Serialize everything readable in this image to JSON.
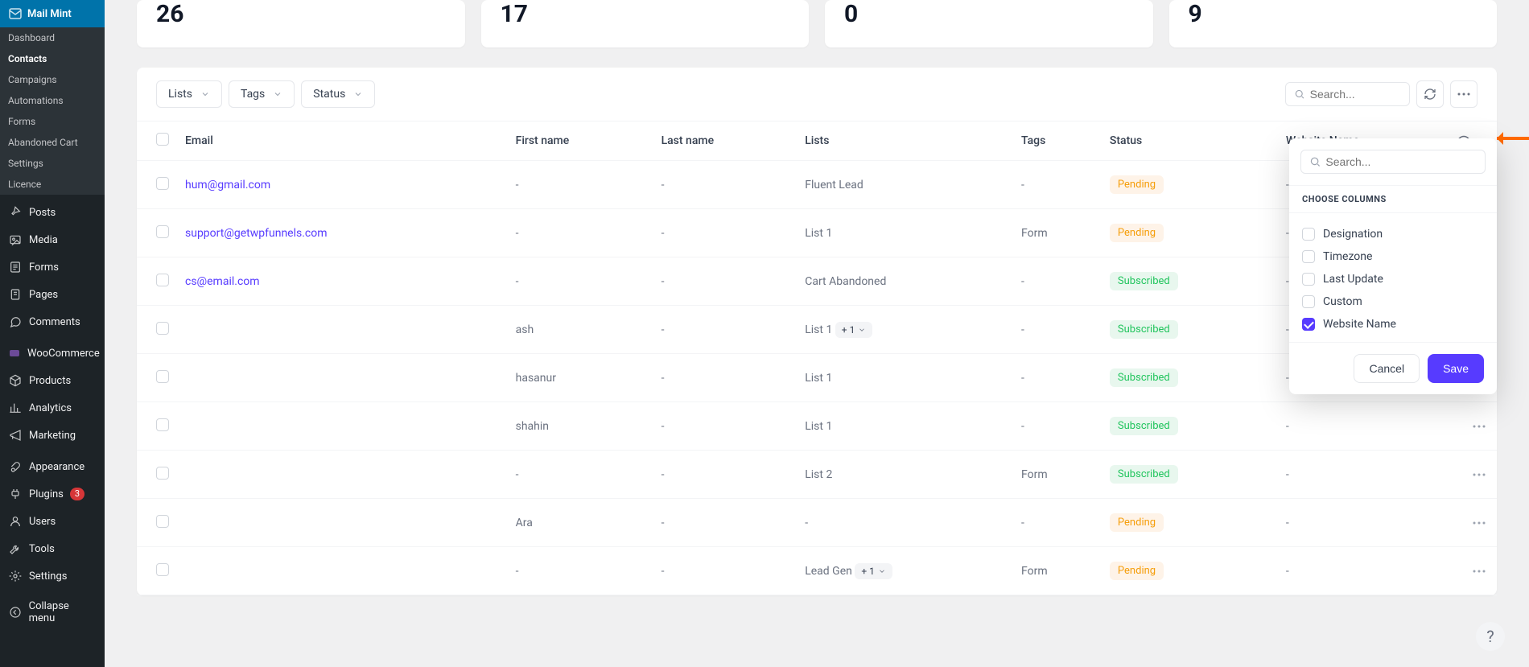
{
  "brand": "Mail Mint",
  "sub": [
    {
      "label": "Dashboard",
      "active": false
    },
    {
      "label": "Contacts",
      "active": true
    },
    {
      "label": "Campaigns",
      "active": false
    },
    {
      "label": "Automations",
      "active": false
    },
    {
      "label": "Forms",
      "active": false
    },
    {
      "label": "Abandoned Cart",
      "active": false
    },
    {
      "label": "Settings",
      "active": false
    },
    {
      "label": "Licence",
      "active": false
    }
  ],
  "wp": [
    {
      "label": "Posts",
      "icon": "pin"
    },
    {
      "label": "Media",
      "icon": "media"
    },
    {
      "label": "Forms",
      "icon": "forms"
    },
    {
      "label": "Pages",
      "icon": "page"
    },
    {
      "label": "Comments",
      "icon": "comment"
    },
    {
      "label": "WooCommerce",
      "icon": "woo",
      "sep": true
    },
    {
      "label": "Products",
      "icon": "product"
    },
    {
      "label": "Analytics",
      "icon": "analytics"
    },
    {
      "label": "Marketing",
      "icon": "marketing"
    },
    {
      "label": "Appearance",
      "icon": "brush",
      "sep": true
    },
    {
      "label": "Plugins",
      "icon": "plugin",
      "badge": "3"
    },
    {
      "label": "Users",
      "icon": "user"
    },
    {
      "label": "Tools",
      "icon": "tool"
    },
    {
      "label": "Settings",
      "icon": "settings"
    },
    {
      "label": "Collapse menu",
      "icon": "collapse",
      "sep": true
    }
  ],
  "stats": [
    "26",
    "17",
    "0",
    "9"
  ],
  "filters": [
    "Lists",
    "Tags",
    "Status"
  ],
  "search_ph": "Search...",
  "cols": [
    "Email",
    "First name",
    "Last name",
    "Lists",
    "Tags",
    "Status",
    "Website Name"
  ],
  "rows": [
    {
      "email": "hum@gmail.com",
      "first": "-",
      "last": "-",
      "lists": "Fluent Lead",
      "tags": "-",
      "status": "Pending",
      "site": "-"
    },
    {
      "email": "support@getwpfunnels.com",
      "first": "-",
      "last": "-",
      "lists": "List 1",
      "tags": "Form",
      "status": "Pending",
      "site": "-"
    },
    {
      "email": "cs@email.com",
      "first": "-",
      "last": "-",
      "lists": "Cart Abandoned",
      "tags": "-",
      "status": "Subscribed",
      "site": "-"
    },
    {
      "email": "",
      "first": "ash",
      "last": "-",
      "lists": "List 1",
      "lists_more": "+ 1",
      "tags": "-",
      "status": "Subscribed",
      "site": "-"
    },
    {
      "email": "",
      "first": "hasanur",
      "last": "-",
      "lists": "List 1",
      "tags": "-",
      "status": "Subscribed",
      "site": "-"
    },
    {
      "email": "",
      "first": "shahin",
      "last": "-",
      "lists": "List 1",
      "tags": "-",
      "status": "Subscribed",
      "site": "-"
    },
    {
      "email": "",
      "first": "-",
      "last": "-",
      "lists": "List 2",
      "tags": "Form",
      "status": "Subscribed",
      "site": "-"
    },
    {
      "email": "",
      "first": "Ara",
      "last": "-",
      "lists": "-",
      "tags": "-",
      "status": "Pending",
      "site": "-"
    },
    {
      "email": "",
      "first": "-",
      "last": "-",
      "lists": "Lead Gen",
      "lists_more": "+ 1",
      "tags": "Form",
      "status": "Pending",
      "site": "-"
    }
  ],
  "popover": {
    "header": "CHOOSE COLUMNS",
    "search_ph": "Search...",
    "opts": [
      {
        "label": "Designation",
        "on": false
      },
      {
        "label": "Timezone",
        "on": false
      },
      {
        "label": "Last Update",
        "on": false
      },
      {
        "label": "Custom",
        "on": false
      },
      {
        "label": "Website Name",
        "on": true
      }
    ],
    "cancel": "Cancel",
    "save": "Save"
  }
}
